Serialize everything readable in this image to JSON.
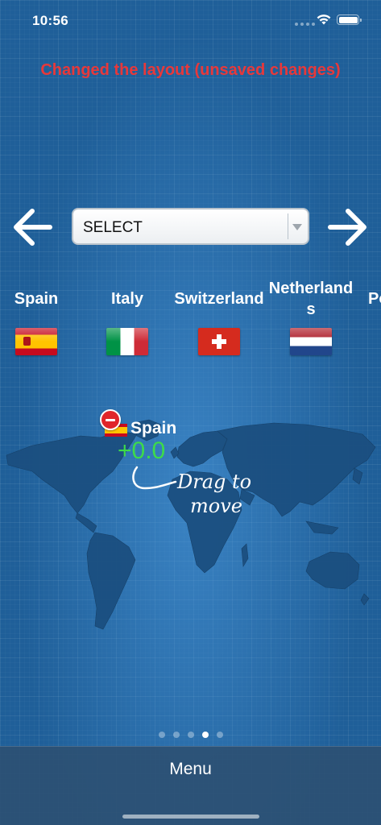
{
  "status_bar": {
    "time": "10:56"
  },
  "warning": "Changed the layout (unsaved changes)",
  "selector": {
    "value": "SELECT"
  },
  "countries": [
    {
      "name": "Spain",
      "flag": "spain-flag"
    },
    {
      "name": "Italy",
      "flag": "italy-flag"
    },
    {
      "name": "Switzerland",
      "flag": "switzerland-flag"
    },
    {
      "name": "Netherlands",
      "flag": "netherlands-flag"
    },
    {
      "name": "Po"
    }
  ],
  "marker": {
    "country": "Spain",
    "offset": "+0.0"
  },
  "hint": {
    "line1": "Drag to",
    "line2": "move"
  },
  "pagination": {
    "count": 5,
    "active_index": 3
  },
  "bottom_bar": {
    "menu_label": "Menu"
  },
  "colors": {
    "warning": "#e8383a",
    "offset": "#3ddb4a",
    "background": "#1f5f99"
  }
}
